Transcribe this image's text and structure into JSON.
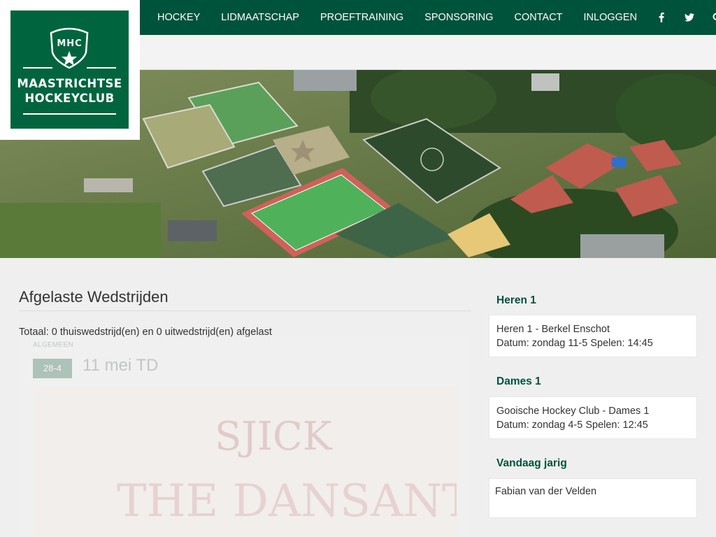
{
  "nav": {
    "items": [
      {
        "label": "HOCKEY"
      },
      {
        "label": "LIDMAATSCHAP"
      },
      {
        "label": "PROEFTRAINING"
      },
      {
        "label": "SPONSORING"
      },
      {
        "label": "CONTACT"
      },
      {
        "label": "INLOGGEN"
      }
    ],
    "icons": [
      "facebook-icon",
      "twitter-icon",
      "search-icon"
    ]
  },
  "logo": {
    "monogram": "MHC",
    "line1": "MAASTRICHTSE",
    "line2": "HOCKEYCLUB"
  },
  "main": {
    "title": "Afgelaste Wedstrijden",
    "totaal": "Totaal: 0 thuiswedstrijd(en) en 0 uitwedstrijd(en) afgelast",
    "post": {
      "category": "ALGEMEEN",
      "date_badge": "28-4",
      "title": "11 mei TD",
      "image_text_1": "SJICK",
      "image_text_2": "THE DANSANT"
    }
  },
  "sidebar": {
    "heren": {
      "heading": "Heren 1",
      "match": "Heren 1 - Berkel Enschot",
      "details": "Datum: zondag 11-5 Spelen: 14:45"
    },
    "dames": {
      "heading": "Dames 1",
      "match": "Gooische Hockey Club - Dames 1",
      "details": "Datum: zondag 4-5 Spelen: 12:45"
    },
    "jarig": {
      "heading": "Vandaag jarig",
      "name": "Fabian van der Velden"
    }
  },
  "colors": {
    "brand_green": "#00533b",
    "logo_green": "#00653f",
    "background": "#efefef"
  }
}
